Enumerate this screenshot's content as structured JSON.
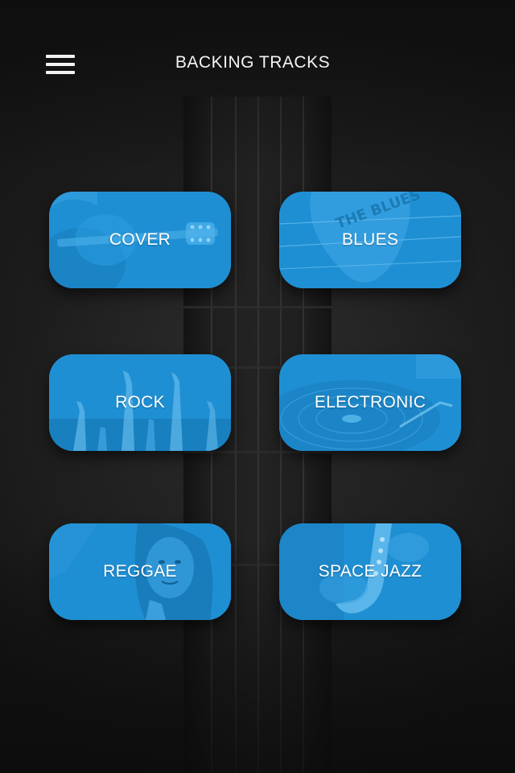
{
  "header": {
    "title": "BACKING TRACKS",
    "menu_icon": "hamburger-menu-icon"
  },
  "genres": [
    {
      "id": "cover",
      "label": "COVER"
    },
    {
      "id": "blues",
      "label": "BLUES",
      "artwork_text": "THE BLUES"
    },
    {
      "id": "rock",
      "label": "ROCK"
    },
    {
      "id": "electronic",
      "label": "ELECTRONIC"
    },
    {
      "id": "reggae",
      "label": "REGGAE"
    },
    {
      "id": "space-jazz",
      "label": "SPACE JAZZ"
    }
  ],
  "colors": {
    "tile_blue": "#1f8fd3",
    "background": "#161616",
    "text": "#ffffff"
  }
}
